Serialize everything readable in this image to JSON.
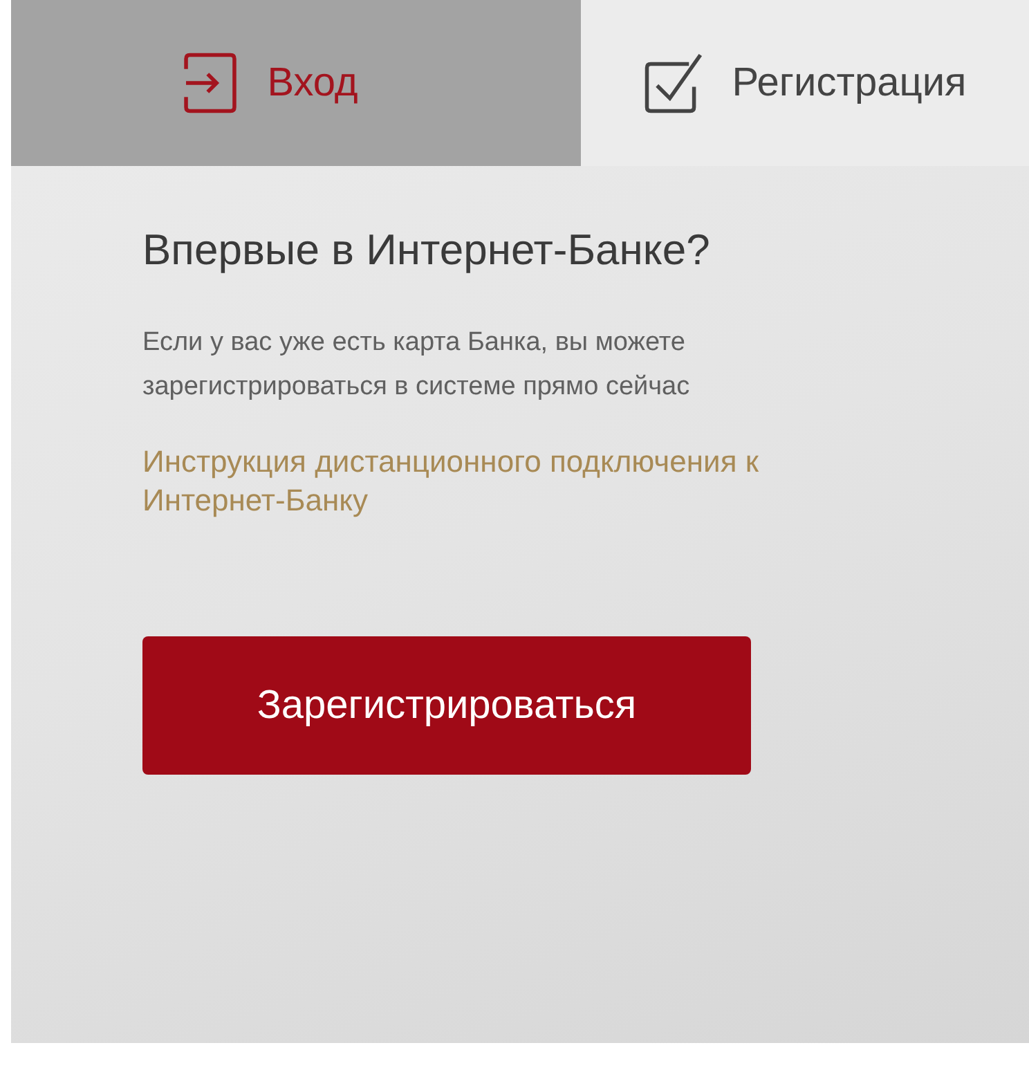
{
  "tabs": [
    {
      "label": "Вход",
      "kind": "login",
      "selected": false
    },
    {
      "label": "Регистрация",
      "kind": "register",
      "selected": true
    }
  ],
  "heading": "Впервые в Интернет-Банке?",
  "description": "Если у вас уже есть карта Банка, вы можете зарегистрироваться в системе прямо сейчас",
  "instruction_link": "Инструкция дистанционного подключения к Интернет-Банку",
  "register_button": "Зарегистрироваться"
}
